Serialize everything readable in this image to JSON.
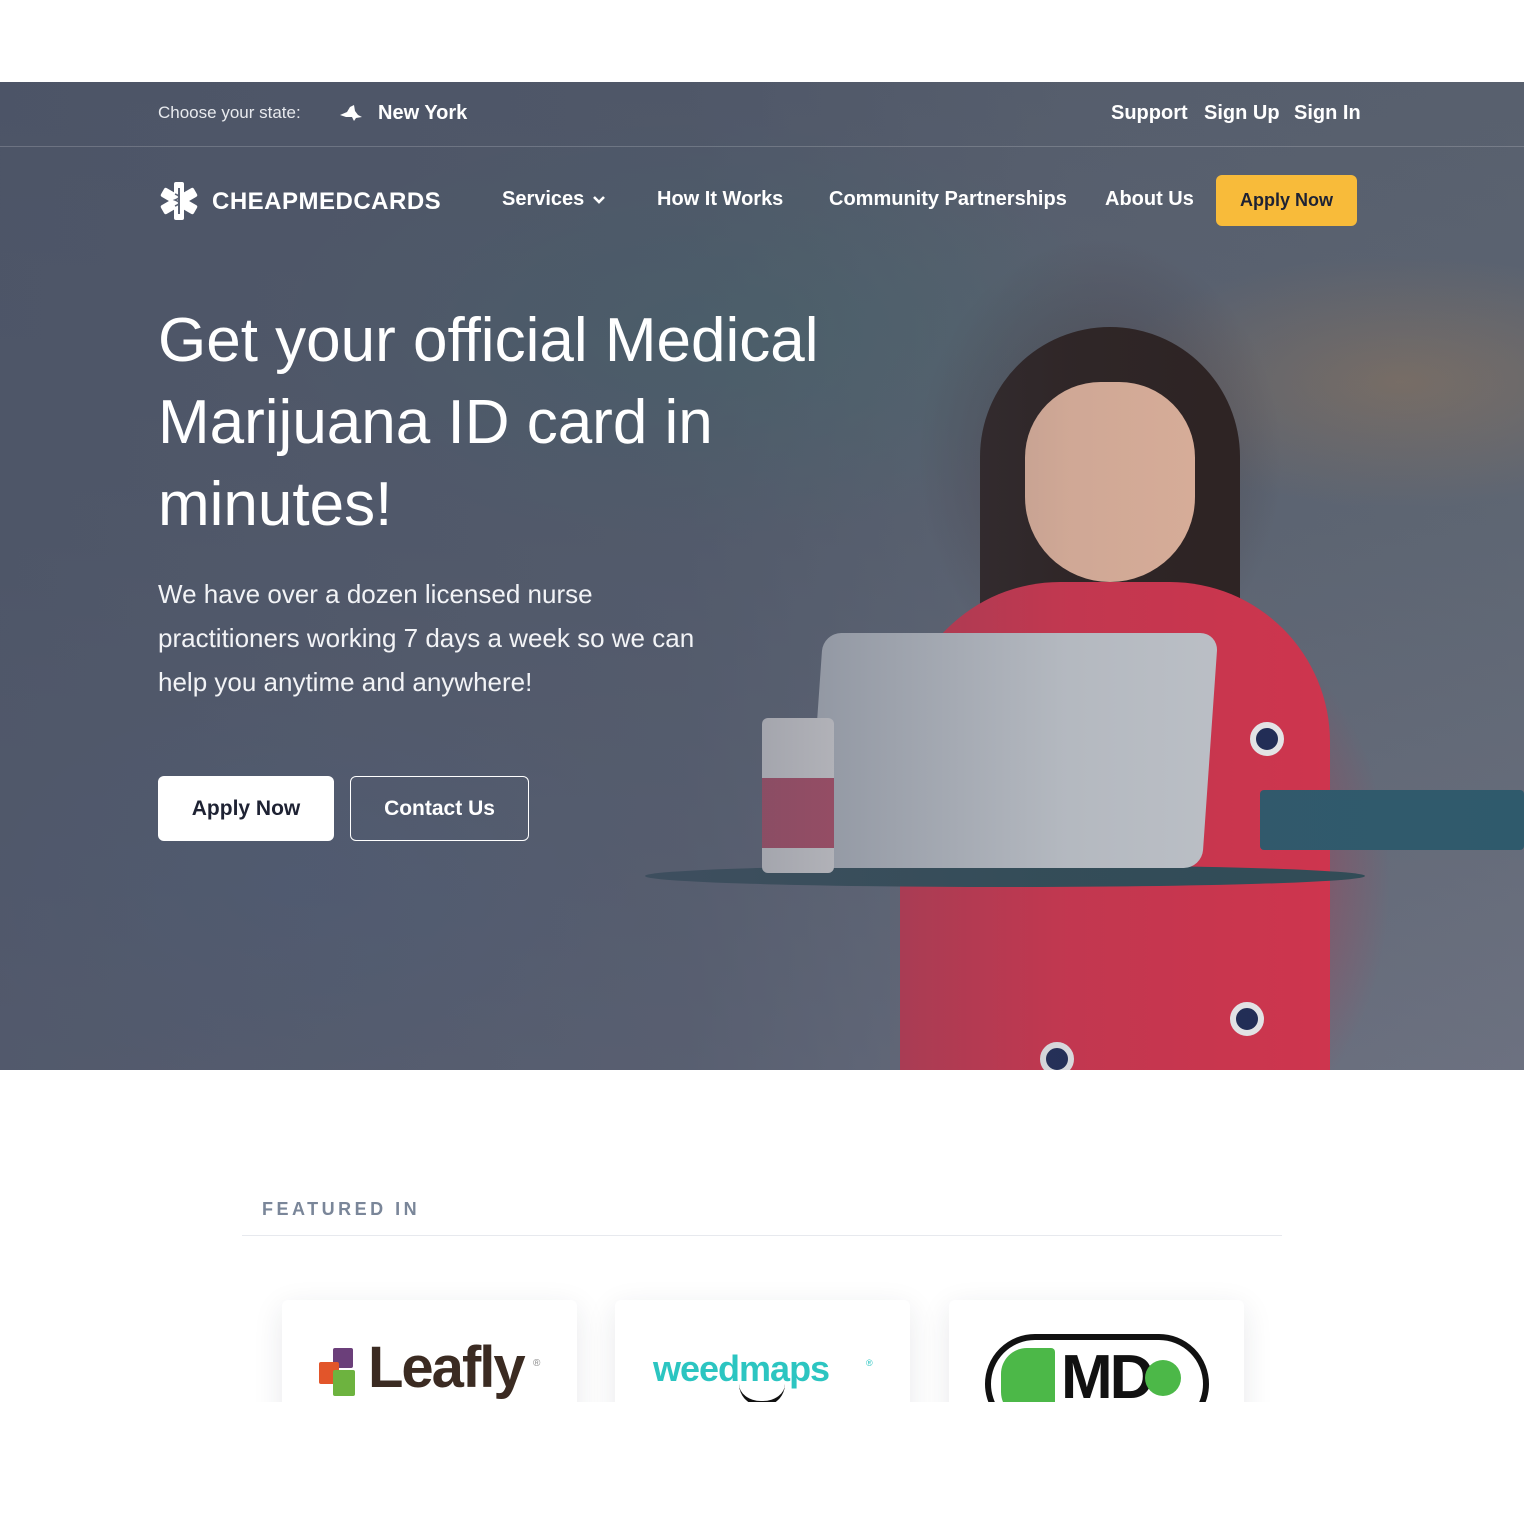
{
  "topbar": {
    "state_label": "Choose your state:",
    "state_name": "New York",
    "links": [
      "Support",
      "Sign Up",
      "Sign In"
    ]
  },
  "nav": {
    "logo_text": "CHEAPMEDCARDS",
    "items": [
      "Services",
      "How It Works",
      "Community Partnerships",
      "About Us"
    ],
    "cta": "Apply Now"
  },
  "hero": {
    "headline": "Get your official Medical Marijuana ID card in minutes!",
    "subtext": "We have over a dozen licensed nurse practitioners working 7 days a week so we can help you anytime and anywhere!",
    "primary_button": "Apply Now",
    "secondary_button": "Contact Us"
  },
  "featured": {
    "title": "FEATURED IN",
    "logos": [
      {
        "name": "Leafly",
        "icon": "leafly-logo"
      },
      {
        "name": "weedmaps",
        "icon": "weedmaps-logo"
      },
      {
        "name": "MD",
        "icon": "md-logo"
      }
    ]
  },
  "colors": {
    "accent": "#f8bb3a",
    "text_dark": "#1e2233",
    "featured_label": "#7a8699",
    "weedmaps": "#2cc5c1",
    "md_green": "#4cb848"
  }
}
